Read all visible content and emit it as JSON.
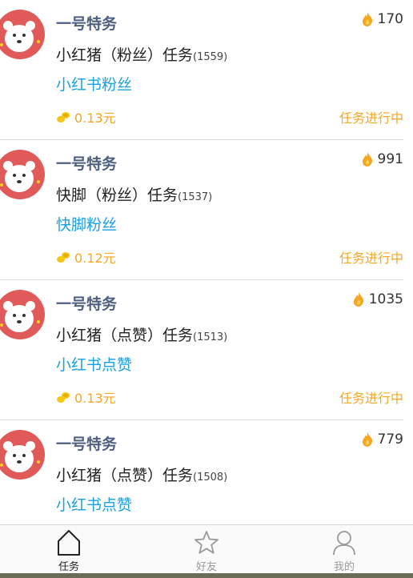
{
  "tasks": [
    {
      "title": "一号特务",
      "heat": "170",
      "name": "小红猪（粉丝）任务",
      "code": "(1559)",
      "platform": "小红书粉丝",
      "reward": "0.13元",
      "status": "任务进行中"
    },
    {
      "title": "一号特务",
      "heat": "991",
      "name": "快脚（粉丝）任务",
      "code": "(1537)",
      "platform": "快脚粉丝",
      "reward": "0.12元",
      "status": "任务进行中"
    },
    {
      "title": "一号特务",
      "heat": "1035",
      "name": "小红猪（点赞）任务",
      "code": "(1513)",
      "platform": "小红书点赞",
      "reward": "0.13元",
      "status": "任务进行中"
    },
    {
      "title": "一号特务",
      "heat": "779",
      "name": "小红猪（点赞）任务",
      "code": "(1508)",
      "platform": "小红书点赞",
      "reward": "",
      "status": ""
    }
  ],
  "tabbar": {
    "tabs": [
      {
        "label": "任务",
        "icon": "home-icon"
      },
      {
        "label": "好友",
        "icon": "star-icon"
      },
      {
        "label": "我的",
        "icon": "person-icon"
      }
    ]
  },
  "colors": {
    "title": "#4e5f82",
    "platform": "#1aa0e0",
    "accent": "#f5a623",
    "flame": "#f5a623",
    "avatar": "#e05a5a"
  }
}
